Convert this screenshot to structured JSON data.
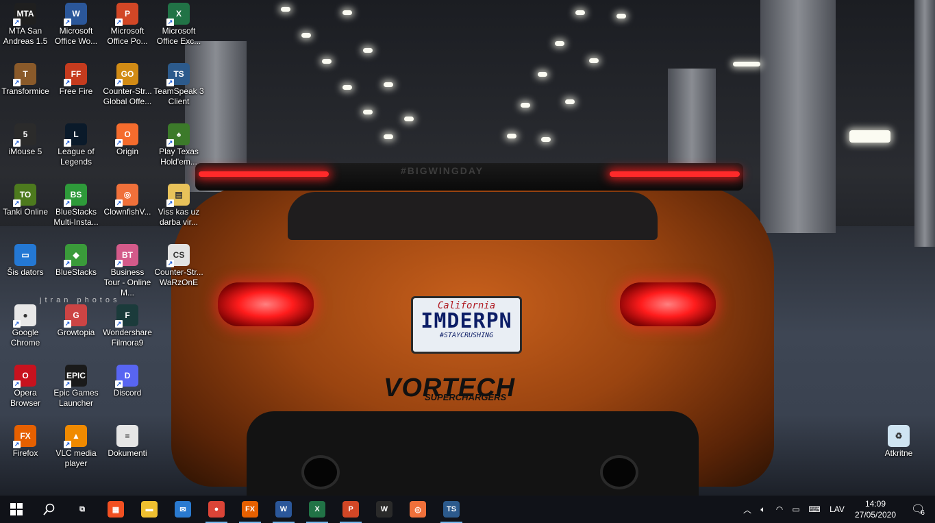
{
  "desktop": {
    "icons": [
      {
        "id": "mta",
        "label": "MTA San Andreas 1.5",
        "color": "#1f1f1f",
        "glyph": "MTA"
      },
      {
        "id": "word",
        "label": "Microsoft Office Wo...",
        "color": "#2b579a",
        "glyph": "W"
      },
      {
        "id": "powerpoint",
        "label": "Microsoft Office Po...",
        "color": "#d24726",
        "glyph": "P"
      },
      {
        "id": "excel",
        "label": "Microsoft Office Exc...",
        "color": "#217346",
        "glyph": "X"
      },
      {
        "id": "transformice",
        "label": "Transformice",
        "color": "#8a5a2a",
        "glyph": "T"
      },
      {
        "id": "freefire",
        "label": "Free Fire",
        "color": "#c53b1e",
        "glyph": "FF"
      },
      {
        "id": "csgo",
        "label": "Counter-Str... Global Offe...",
        "color": "#d18b15",
        "glyph": "GO"
      },
      {
        "id": "teamspeak",
        "label": "TeamSpeak 3 Client",
        "color": "#2c5a8c",
        "glyph": "TS"
      },
      {
        "id": "imouse",
        "label": "iMouse 5",
        "color": "#2b2b2b",
        "glyph": "5"
      },
      {
        "id": "lol",
        "label": "League of Legends",
        "color": "#0a1a2a",
        "glyph": "L"
      },
      {
        "id": "origin",
        "label": "Origin",
        "color": "#f56c2d",
        "glyph": "O"
      },
      {
        "id": "texas",
        "label": "Play Texas Hold'em...",
        "color": "#3c7a2a",
        "glyph": "♠"
      },
      {
        "id": "tanki",
        "label": "Tanki Online",
        "color": "#4d7a1e",
        "glyph": "TO"
      },
      {
        "id": "bluestacks-multi",
        "label": "BlueStacks Multi-Insta...",
        "color": "#2e9a3a",
        "glyph": "BS"
      },
      {
        "id": "clownfish",
        "label": "ClownfishV...",
        "color": "#f0703a",
        "glyph": "◎"
      },
      {
        "id": "viss",
        "label": "Viss kas uz darba vir...",
        "color": "#e8c25a",
        "glyph": "▤"
      },
      {
        "id": "thispc",
        "label": "Šis dators",
        "color": "#2478d4",
        "glyph": "▭"
      },
      {
        "id": "bluestacks",
        "label": "BlueStacks",
        "color": "#3a9b3a",
        "glyph": "◆"
      },
      {
        "id": "businesstour",
        "label": "Business Tour - Online M...",
        "color": "#d45a8a",
        "glyph": "BT"
      },
      {
        "id": "cs-warzone",
        "label": "Counter-Str... WaRzOnE",
        "color": "#e3e3e3",
        "glyph": "CS"
      },
      {
        "id": "chrome",
        "label": "Google Chrome",
        "color": "#e8e8e8",
        "glyph": "●"
      },
      {
        "id": "growtopia",
        "label": "Growtopia",
        "color": "#c44",
        "glyph": "G"
      },
      {
        "id": "filmora",
        "label": "Wondershare Filmora9",
        "color": "#1b3b3b",
        "glyph": "F"
      },
      {
        "id": "opera",
        "label": "Opera Browser",
        "color": "#c8121e",
        "glyph": "O"
      },
      {
        "id": "epic",
        "label": "Epic Games Launcher",
        "color": "#1a1a1a",
        "glyph": "EPIC"
      },
      {
        "id": "discord",
        "label": "Discord",
        "color": "#5865f2",
        "glyph": "D"
      },
      {
        "id": "firefox",
        "label": "Firefox",
        "color": "#e66000",
        "glyph": "FX"
      },
      {
        "id": "vlc",
        "label": "VLC media player",
        "color": "#f08a00",
        "glyph": "▲"
      },
      {
        "id": "docs",
        "label": "Dokumenti",
        "color": "#e6e6e6",
        "glyph": "≡"
      },
      {
        "id": "recycle",
        "label": "Atkritne",
        "color": "#cfe4f2",
        "glyph": "♻"
      }
    ]
  },
  "wallpaper": {
    "wing_text": "#BIGWINGDAY",
    "plate_state": "California",
    "plate_number": "IMDERPN",
    "plate_tag": "#STAYCRUSHING",
    "brand": "VORTECH",
    "brand_sub": "SUPERCHARGERS",
    "watermark": "jtran photos"
  },
  "taskbar": {
    "pinned": [
      {
        "id": "task-view",
        "glyph": "⧉",
        "color": "transparent"
      },
      {
        "id": "store",
        "glyph": "▦",
        "color": "#f25022"
      },
      {
        "id": "explorer",
        "glyph": "▬",
        "color": "#f0c030"
      },
      {
        "id": "mail",
        "glyph": "✉",
        "color": "#2a7ad0"
      },
      {
        "id": "chrome",
        "glyph": "●",
        "color": "#db4437"
      },
      {
        "id": "firefox",
        "glyph": "FX",
        "color": "#e66000"
      },
      {
        "id": "word",
        "glyph": "W",
        "color": "#2b579a"
      },
      {
        "id": "excel",
        "glyph": "X",
        "color": "#217346"
      },
      {
        "id": "powerpoint",
        "glyph": "P",
        "color": "#d24726"
      },
      {
        "id": "wot",
        "glyph": "W",
        "color": "#2a2a2a"
      },
      {
        "id": "clownfish",
        "glyph": "◎",
        "color": "#f0703a"
      },
      {
        "id": "teamspeak",
        "glyph": "TS",
        "color": "#2c5a8c"
      }
    ],
    "tray": {
      "language": "LAV",
      "time": "14:09",
      "date": "27/05/2020",
      "notifications": "6"
    }
  }
}
